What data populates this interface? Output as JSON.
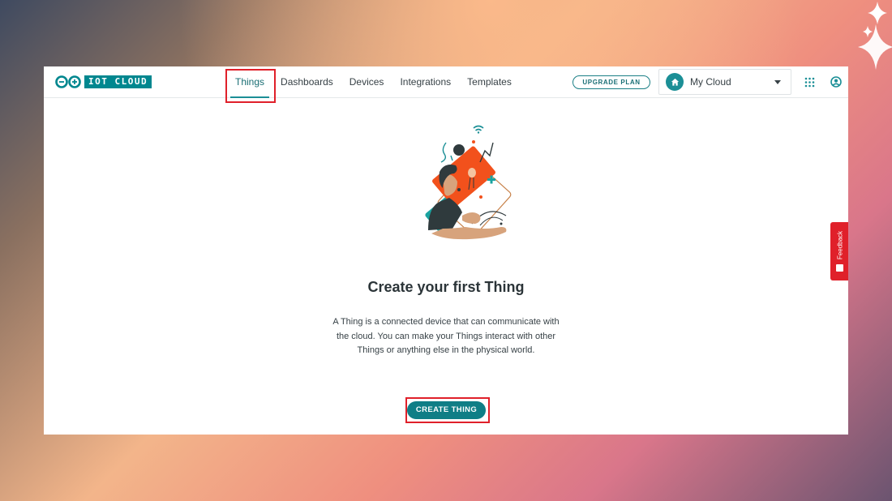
{
  "app": {
    "logo_text": "IOT CLOUD"
  },
  "nav": {
    "tabs": [
      {
        "label": "Things",
        "active": true
      },
      {
        "label": "Dashboards",
        "active": false
      },
      {
        "label": "Devices",
        "active": false
      },
      {
        "label": "Integrations",
        "active": false
      },
      {
        "label": "Templates",
        "active": false
      }
    ]
  },
  "header": {
    "upgrade_label": "UPGRADE PLAN",
    "cloud_selector": {
      "selected": "My Cloud"
    },
    "icons": [
      "apps-grid-icon",
      "user-account-icon"
    ]
  },
  "main": {
    "title": "Create your first Thing",
    "description": "A Thing is a connected device that can communicate with the cloud. You can make your Things interact with other Things or anything else in the physical world.",
    "cta_label": "CREATE THING"
  },
  "feedback": {
    "label": "Feedback"
  },
  "colors": {
    "brand_teal": "#00878f",
    "button_teal": "#0f7e86",
    "highlight_red": "#e0202a"
  }
}
